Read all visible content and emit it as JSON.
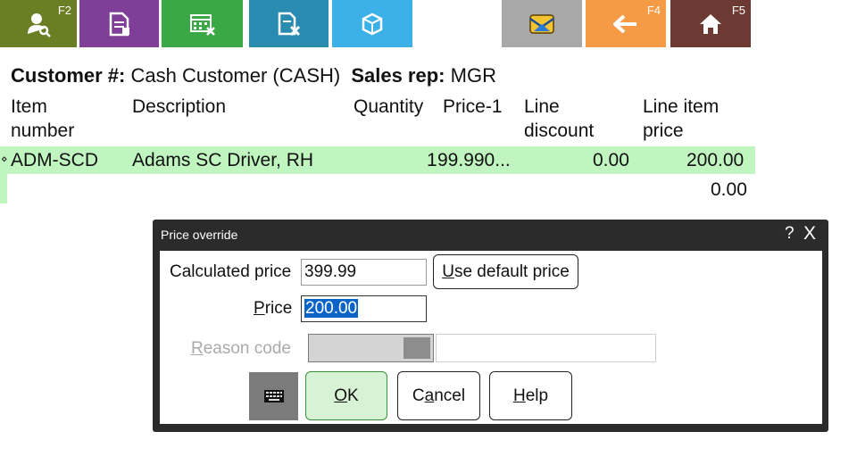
{
  "toolbar": {
    "customer_lookup": {
      "icon": "customer-search-icon",
      "fkey": "F2"
    },
    "document": {
      "icon": "document-icon"
    },
    "calculator": {
      "icon": "calculator-delete-icon"
    },
    "document_delete": {
      "icon": "document-delete-icon"
    },
    "package": {
      "icon": "package-icon"
    },
    "mail": {
      "icon": "mail-icon"
    },
    "back": {
      "icon": "back-arrow-icon",
      "fkey": "F4"
    },
    "home": {
      "icon": "home-icon",
      "fkey": "F5"
    }
  },
  "header": {
    "customer_label": "Customer #:",
    "customer_value": "Cash Customer (CASH)",
    "salesrep_label": "Sales rep:",
    "salesrep_value": "MGR"
  },
  "table": {
    "columns": [
      {
        "line1": "Item",
        "line2": "number"
      },
      {
        "line1": "Description",
        "line2": ""
      },
      {
        "line1": "Quantity",
        "line2": ""
      },
      {
        "line1": "Price-1",
        "line2": ""
      },
      {
        "line1": "Line",
        "line2": "discount"
      },
      {
        "line1": "Line item",
        "line2": "price"
      }
    ],
    "rows": [
      {
        "item": "ADM-SCD",
        "description": "Adams SC Driver, RH",
        "quantity": "1",
        "price": "99.990...",
        "discount": "0.00",
        "line_price": "200.00"
      }
    ],
    "total": "0.00"
  },
  "dialog": {
    "title": "Price override",
    "help": "?",
    "close": "X",
    "calculated_label": "Calculated price",
    "calculated_value": "399.99",
    "use_default_label": "Use default price",
    "use_default_accel": "U",
    "use_default_rest": "se default price",
    "price_label_accel": "P",
    "price_label_rest": "rice",
    "price_value": "200.00",
    "reason_label_accel": "R",
    "reason_label_rest": "eason code",
    "ok_accel": "O",
    "ok_rest": "K",
    "cancel_pre": "C",
    "cancel_accel": "a",
    "cancel_rest": "ncel",
    "help_accel": "H",
    "help_rest": "elp"
  },
  "colors": {
    "accent_green": "#c0f5c0",
    "selection": "#0a64c8"
  }
}
